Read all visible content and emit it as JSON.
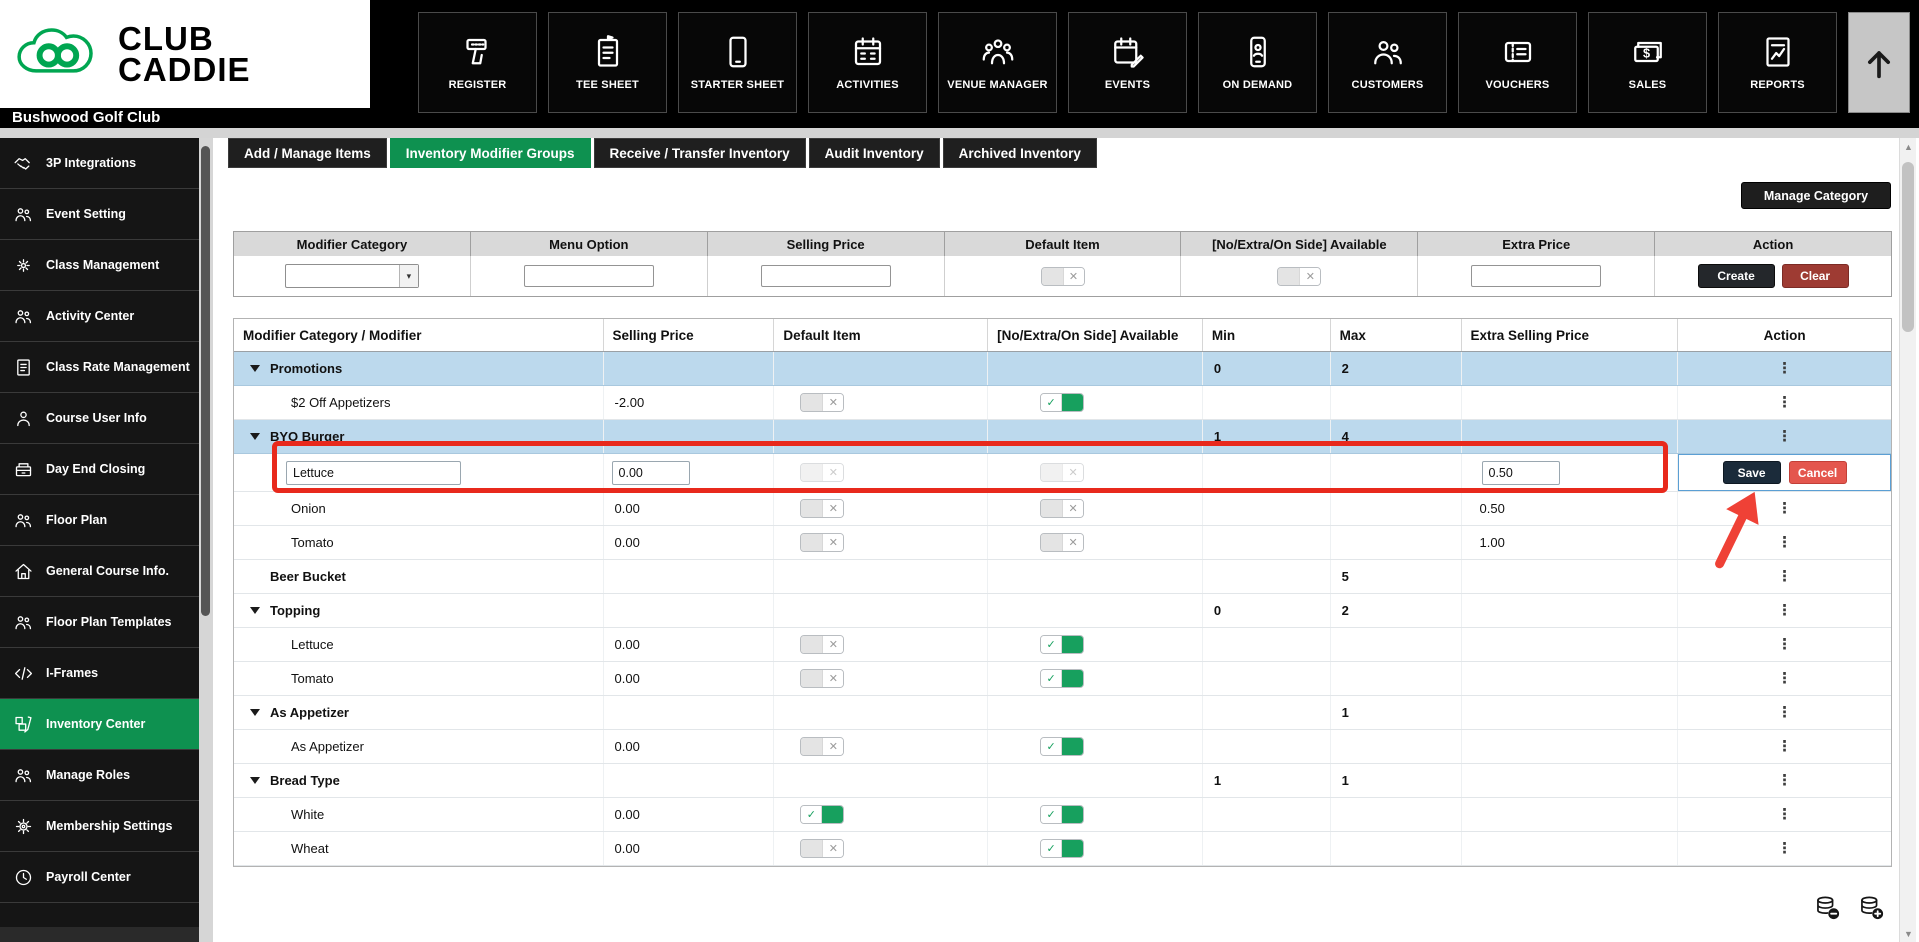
{
  "brand": {
    "logo_line1": "CLUB",
    "logo_line2": "CADDIE",
    "club_name": "Bushwood Golf Club",
    "green": "#00a651"
  },
  "top_nav": {
    "items": [
      {
        "label": "REGISTER",
        "icon": "barcode-scanner-icon"
      },
      {
        "label": "TEE SHEET",
        "icon": "tee-sheet-icon"
      },
      {
        "label": "STARTER SHEET",
        "icon": "tablet-icon"
      },
      {
        "label": "ACTIVITIES",
        "icon": "calendar-icon"
      },
      {
        "label": "VENUE MANAGER",
        "icon": "venue-icon"
      },
      {
        "label": "EVENTS",
        "icon": "calendar-edit-icon"
      },
      {
        "label": "ON DEMAND",
        "icon": "phone-icon"
      },
      {
        "label": "CUSTOMERS",
        "icon": "customers-icon"
      },
      {
        "label": "VOUCHERS",
        "icon": "voucher-icon"
      },
      {
        "label": "SALES",
        "icon": "money-icon"
      },
      {
        "label": "REPORTS",
        "icon": "report-icon"
      }
    ]
  },
  "sidebar": {
    "items": [
      {
        "label": "3P Integrations",
        "icon": "handshake-icon",
        "active": false
      },
      {
        "label": "Event Setting",
        "icon": "people-icon",
        "active": false
      },
      {
        "label": "Class Management",
        "icon": "gear-people-icon",
        "active": false
      },
      {
        "label": "Activity Center",
        "icon": "people-icon",
        "active": false
      },
      {
        "label": "Class Rate Management",
        "icon": "document-icon",
        "active": false
      },
      {
        "label": "Course User Info",
        "icon": "person-icon",
        "active": false
      },
      {
        "label": "Day End Closing",
        "icon": "cash-drawer-icon",
        "active": false
      },
      {
        "label": "Floor Plan",
        "icon": "people-icon",
        "active": false
      },
      {
        "label": "General Course Info.",
        "icon": "home-icon",
        "active": false
      },
      {
        "label": "Floor Plan Templates",
        "icon": "people-icon",
        "active": false
      },
      {
        "label": "I-Frames",
        "icon": "code-icon",
        "active": false
      },
      {
        "label": "Inventory Center",
        "icon": "inventory-icon",
        "active": true
      },
      {
        "label": "Manage Roles",
        "icon": "people-icon",
        "active": false
      },
      {
        "label": "Membership Settings",
        "icon": "gear-icon",
        "active": false
      },
      {
        "label": "Payroll Center",
        "icon": "clock-icon",
        "active": false
      }
    ]
  },
  "tabs": [
    {
      "label": "Add / Manage Items",
      "active": false
    },
    {
      "label": "Inventory Modifier Groups",
      "active": true
    },
    {
      "label": "Receive / Transfer Inventory",
      "active": false
    },
    {
      "label": "Audit Inventory",
      "active": false
    },
    {
      "label": "Archived Inventory",
      "active": false
    }
  ],
  "toolbar": {
    "manage_category_label": "Manage Category"
  },
  "filter_bar": {
    "headers": [
      "Modifier Category",
      "Menu Option",
      "Selling Price",
      "Default Item",
      "[No/Extra/On Side] Available",
      "Extra Price",
      "Action"
    ],
    "modifier_category_value": "",
    "menu_option_value": "",
    "selling_price_value": "",
    "extra_price_value": "",
    "default_item_toggle": "off",
    "available_toggle": "off",
    "create_label": "Create",
    "clear_label": "Clear"
  },
  "grid": {
    "columns": [
      "Modifier Category / Modifier",
      "Selling Price",
      "Default Item",
      "[No/Extra/On Side] Available",
      "Min",
      "Max",
      "Extra Selling Price",
      "Action"
    ],
    "rows": [
      {
        "type": "group",
        "name": "Promotions",
        "min": "0",
        "max": "2",
        "selected": true
      },
      {
        "type": "item",
        "name": "$2 Off Appetizers",
        "selling": "-2.00",
        "default": "off",
        "available": "on",
        "extra": ""
      },
      {
        "type": "group",
        "name": "BYO Burger",
        "min": "1",
        "max": "4",
        "selected": true
      },
      {
        "type": "edit",
        "name_value": "Lettuce",
        "selling_value": "0.00",
        "default": "off-disabled",
        "available": "off-disabled",
        "extra_value": "0.50",
        "save_label": "Save",
        "cancel_label": "Cancel"
      },
      {
        "type": "item",
        "name": "Onion",
        "selling": "0.00",
        "default": "off",
        "available": "off",
        "extra": "0.50"
      },
      {
        "type": "item",
        "name": "Tomato",
        "selling": "0.00",
        "default": "off",
        "available": "off",
        "extra": "1.00"
      },
      {
        "type": "group",
        "name": "Beer Bucket",
        "min": "",
        "max": "5",
        "arrow": false,
        "selected": false
      },
      {
        "type": "group",
        "name": "Topping",
        "min": "0",
        "max": "2",
        "selected": false
      },
      {
        "type": "item",
        "name": "Lettuce",
        "selling": "0.00",
        "default": "off",
        "available": "on",
        "extra": ""
      },
      {
        "type": "item",
        "name": "Tomato",
        "selling": "0.00",
        "default": "off",
        "available": "on",
        "extra": ""
      },
      {
        "type": "group",
        "name": "As Appetizer",
        "min": "",
        "max": "1",
        "selected": false
      },
      {
        "type": "item",
        "name": "As Appetizer",
        "selling": "0.00",
        "default": "off",
        "available": "on",
        "extra": ""
      },
      {
        "type": "group",
        "name": "Bread Type",
        "min": "1",
        "max": "1",
        "selected": false
      },
      {
        "type": "item",
        "name": "White",
        "selling": "0.00",
        "default": "on",
        "available": "on",
        "extra": ""
      },
      {
        "type": "item",
        "name": "Wheat",
        "selling": "0.00",
        "default": "off",
        "available": "on",
        "extra": ""
      }
    ]
  },
  "annotation": {
    "highlight_color": "#e8291c",
    "arrow_color": "#ef4136"
  },
  "footer_icons": [
    "sync-remove-icon",
    "sync-add-icon"
  ]
}
